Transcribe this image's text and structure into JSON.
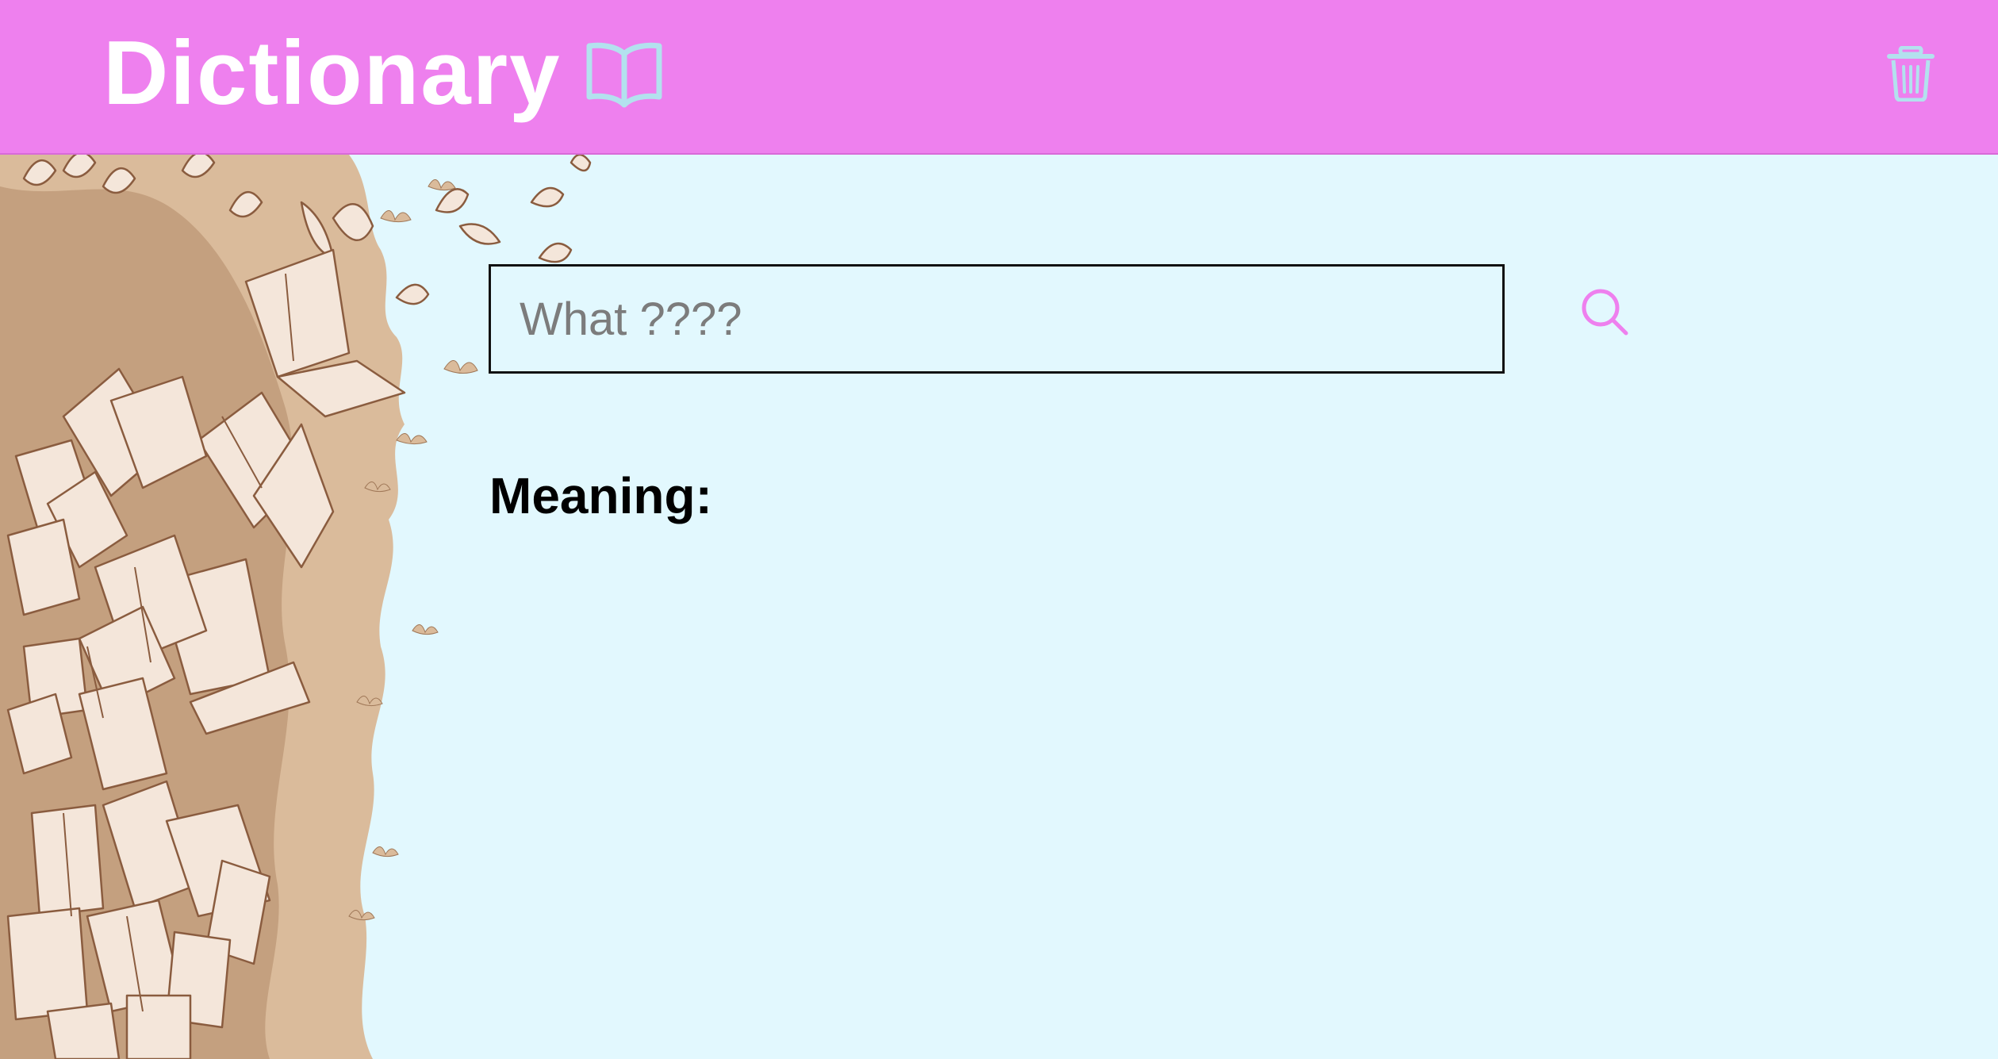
{
  "header": {
    "title": "Dictionary",
    "background_color": "#ee80ee",
    "title_color": "#ffffff",
    "title_icon": "open-book-icon",
    "title_icon_color": "#b3e1ee",
    "clear_icon": "trash-icon",
    "clear_icon_color": "#b3e1ee"
  },
  "search": {
    "placeholder": "What ????",
    "value": "",
    "button_icon": "search-icon",
    "button_icon_color": "#ee80ee"
  },
  "result": {
    "label": "Meaning:",
    "text": ""
  },
  "illustration": {
    "subject": "flying-books-illustration",
    "colors": [
      "#dabb9b",
      "#c4a07f",
      "#f4e6da",
      "#8a5c3f"
    ]
  },
  "colors": {
    "page_background": "#e2f8fe",
    "input_border": "#111111"
  }
}
